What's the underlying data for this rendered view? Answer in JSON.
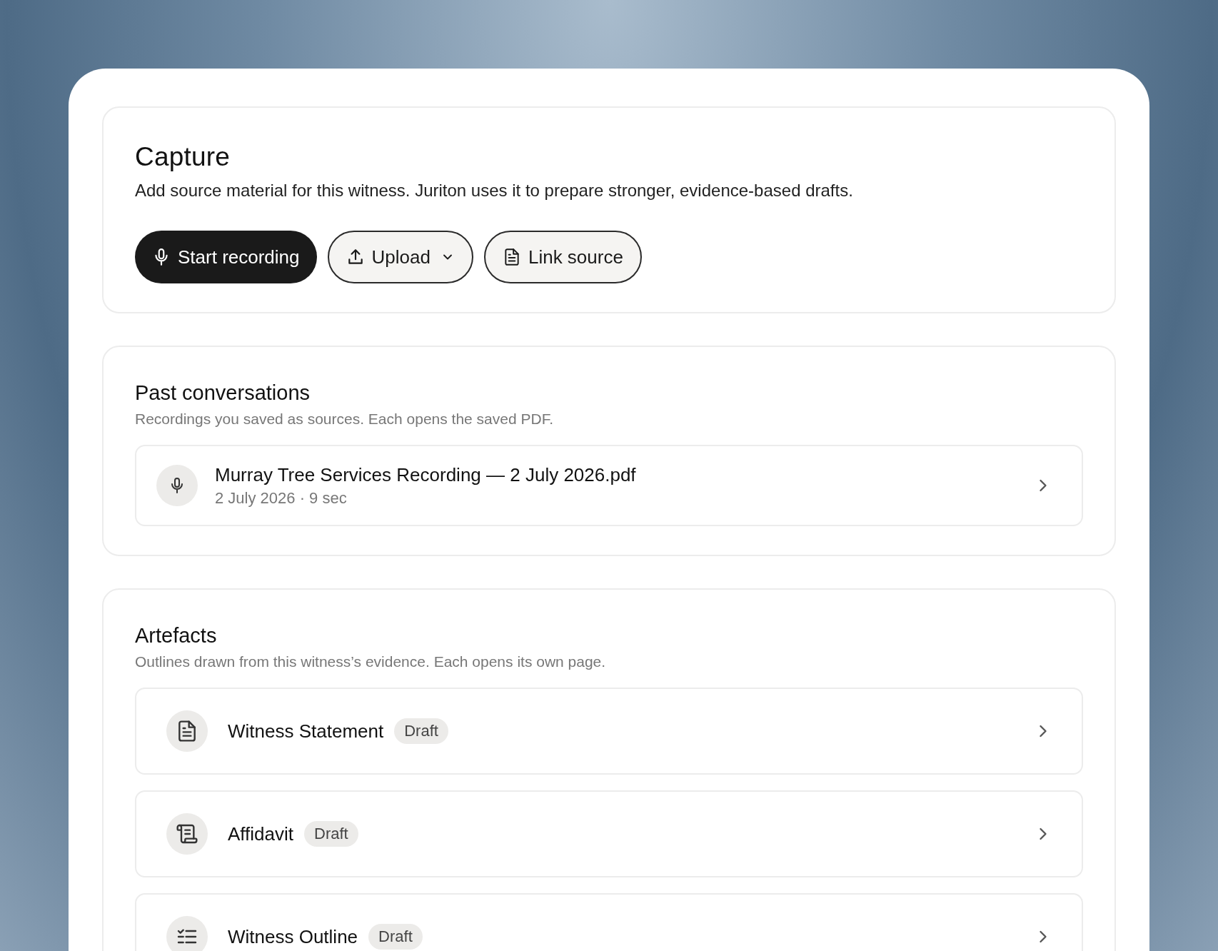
{
  "capture": {
    "title": "Capture",
    "description": "Add source material for this witness. Juriton uses it to prepare stronger, evidence-based drafts.",
    "buttons": [
      {
        "label": "Start recording",
        "kind": "primary"
      },
      {
        "label": "Upload",
        "kind": "dropdown"
      },
      {
        "label": "Link source",
        "kind": "link"
      }
    ]
  },
  "past_conversations": {
    "title": "Past conversations",
    "subtitle": "Recordings you saved as sources. Each opens the saved PDF.",
    "items": [
      {
        "title": "Murray Tree Services Recording — 2 July 2026.pdf",
        "meta": "2 July 2026 · 9 sec"
      }
    ]
  },
  "artefacts": {
    "title": "Artefacts",
    "subtitle": "Outlines drawn from this witness’s evidence. Each opens its own page.",
    "items": [
      {
        "title": "Witness Statement",
        "badge": "Draft"
      },
      {
        "title": "Affidavit",
        "badge": "Draft"
      },
      {
        "title": "Witness Outline",
        "badge": "Draft"
      }
    ]
  }
}
